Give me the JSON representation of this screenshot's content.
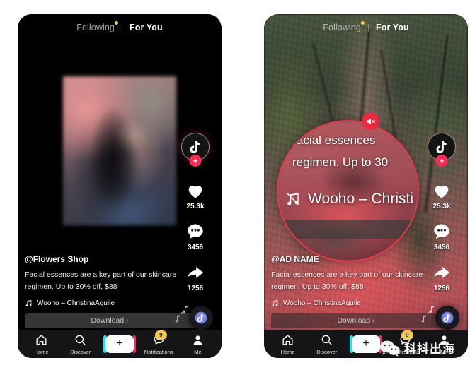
{
  "colors": {
    "accent_red": "#fe2c55",
    "accent_cyan": "#24e5ee",
    "badge_yellow": "#f2c94c",
    "magnifier_border": "#e03a4e",
    "mute_badge": "#e8293f",
    "nav_background": "#151518",
    "screen_background": "#000000"
  },
  "top_tabs": {
    "following": "Following",
    "for_you": "For You",
    "active": "For You",
    "dot_icon": "notification-dot"
  },
  "left_phone": {
    "feed": {
      "handle": "@Flowers Shop",
      "description": "Facial essences are a key part of our skincare regimen. Up to 30% off, $88",
      "music": "Wooho – ChristinaAguile",
      "music_icon": "music-note-icon",
      "cta_label": "Download ›"
    },
    "rail": {
      "avatar_icon": "tiktok-note-icon",
      "follow_badge": "+",
      "items": [
        {
          "icon": "heart-icon",
          "count": "25.3k"
        },
        {
          "icon": "comment-icon",
          "count": "3456"
        },
        {
          "icon": "share-icon",
          "count": "1256"
        }
      ]
    },
    "disc": {
      "icon": "tiktok-note-icon",
      "notes_icon": "floating-music-notes-icon"
    },
    "nav": {
      "items": [
        {
          "icon": "home-icon",
          "label": "Home",
          "badge": ""
        },
        {
          "icon": "search-icon",
          "label": "Discover",
          "badge": ""
        },
        {
          "icon": "plus-icon",
          "label": "",
          "badge": ""
        },
        {
          "icon": "notifications-icon",
          "label": "Notifications",
          "badge": "9"
        },
        {
          "icon": "profile-icon",
          "label": "Me",
          "badge": ""
        }
      ],
      "create_label": "+"
    }
  },
  "right_phone": {
    "feed": {
      "handle": "@AD NAME",
      "description": "Facial essences are a key part of our skincare regimen. Up to 30% off, $88",
      "music": "Wooho – ChristinaAguile",
      "music_icon": "music-note-icon",
      "cta_label": "Download ›"
    },
    "rail": {
      "avatar_icon": "tiktok-note-icon",
      "follow_badge": "+",
      "items": [
        {
          "icon": "heart-icon",
          "count": "25.3k"
        },
        {
          "icon": "comment-icon",
          "count": "3456"
        },
        {
          "icon": "share-icon",
          "count": "1256"
        }
      ]
    },
    "disc": {
      "icon": "tiktok-note-icon",
      "notes_icon": "floating-music-notes-icon"
    },
    "nav": {
      "items": [
        {
          "icon": "home-icon",
          "label": "Home",
          "badge": ""
        },
        {
          "icon": "search-icon",
          "label": "Discover",
          "badge": ""
        },
        {
          "icon": "plus-icon",
          "label": "",
          "badge": ""
        },
        {
          "icon": "notifications-icon",
          "label": "Notifications",
          "badge": "9"
        },
        {
          "icon": "profile-icon",
          "label": "Me",
          "badge": ""
        }
      ],
      "create_label": "+"
    },
    "magnifier": {
      "line1": "acial essences",
      "line2": "regimen. Up to 30",
      "music": "Wooho – Christi",
      "music_icon": "music-note-muted-icon",
      "mute_badge_icon": "speaker-mute-icon"
    },
    "watermark": {
      "logo_icon": "wechat-logo-icon",
      "text": "科抖出海"
    }
  }
}
